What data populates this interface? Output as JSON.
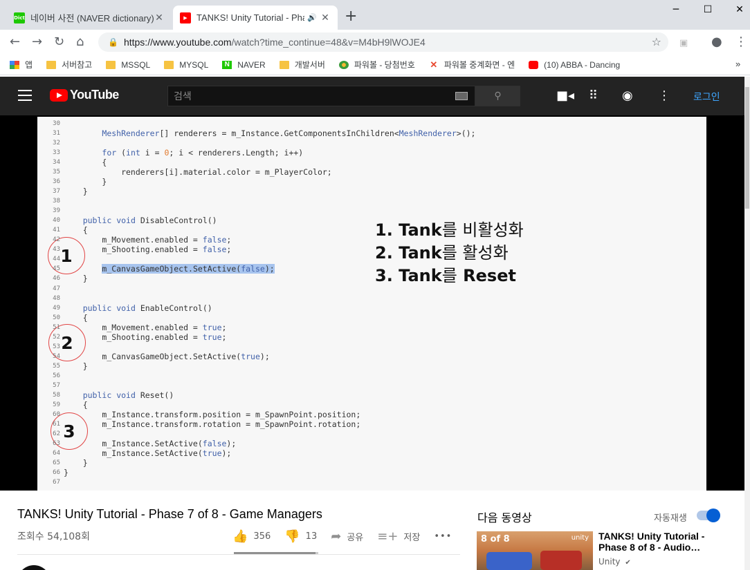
{
  "browser": {
    "tabs": [
      {
        "title": "네이버 사전 (NAVER dictionary)",
        "favicon": "naver-dict-icon",
        "close": "✕"
      },
      {
        "title": "TANKS! Unity Tutorial - Pha",
        "favicon": "youtube-icon",
        "close": "✕",
        "active": true
      }
    ],
    "new_tab": "+",
    "window_controls": {
      "minimize": "─",
      "maximize": "☐",
      "close": "✕"
    },
    "nav": {
      "back": "←",
      "forward": "→",
      "reload": "↻",
      "home": "⌂"
    },
    "url_host": "https://www.youtube.com",
    "url_path": "/watch?time_continue=48&v=M4bH9lWOJE4",
    "bookmarks": [
      {
        "label": "앱",
        "icon": "apps-grid-icon"
      },
      {
        "label": "서버참고",
        "icon": "folder-icon"
      },
      {
        "label": "MSSQL",
        "icon": "folder-icon"
      },
      {
        "label": "MYSQL",
        "icon": "folder-icon"
      },
      {
        "label": "NAVER",
        "icon": "naver-icon"
      },
      {
        "label": "개발서버",
        "icon": "folder-icon"
      },
      {
        "label": "파워볼 - 당첨번호",
        "icon": "powerball-icon"
      },
      {
        "label": "파워볼 중계화면 - 엔",
        "icon": "powerball-broadcast-icon"
      },
      {
        "label": "(10) ABBA - Dancing",
        "icon": "youtube-icon"
      }
    ],
    "bookmarks_more": "»"
  },
  "youtube": {
    "logo_text": "YouTube",
    "search_placeholder": "검색",
    "login": "로그인"
  },
  "code": {
    "lines": [
      {
        "n": "30",
        "t": ""
      },
      {
        "n": "31",
        "t": "        MeshRenderer[] renderers = m_Instance.GetComponentsInChildren<MeshRenderer>();"
      },
      {
        "n": "32",
        "t": ""
      },
      {
        "n": "33",
        "t": "        for (int i = 0; i < renderers.Length; i++)"
      },
      {
        "n": "34",
        "t": "        {"
      },
      {
        "n": "35",
        "t": "            renderers[i].material.color = m_PlayerColor;"
      },
      {
        "n": "36",
        "t": "        }"
      },
      {
        "n": "37",
        "t": "    }"
      },
      {
        "n": "38",
        "t": ""
      },
      {
        "n": "39",
        "t": ""
      },
      {
        "n": "40",
        "t": "    public void DisableControl()"
      },
      {
        "n": "41",
        "t": "    {"
      },
      {
        "n": "42",
        "t": "        m_Movement.enabled = false;"
      },
      {
        "n": "43",
        "t": "        m_Shooting.enabled = false;"
      },
      {
        "n": "44",
        "t": ""
      },
      {
        "n": "45",
        "t": "        m_CanvasGameObject.SetActive(false);"
      },
      {
        "n": "46",
        "t": "    }"
      },
      {
        "n": "47",
        "t": ""
      },
      {
        "n": "48",
        "t": ""
      },
      {
        "n": "49",
        "t": "    public void EnableControl()"
      },
      {
        "n": "50",
        "t": "    {"
      },
      {
        "n": "51",
        "t": "        m_Movement.enabled = true;"
      },
      {
        "n": "52",
        "t": "        m_Shooting.enabled = true;"
      },
      {
        "n": "53",
        "t": ""
      },
      {
        "n": "54",
        "t": "        m_CanvasGameObject.SetActive(true);"
      },
      {
        "n": "55",
        "t": "    }"
      },
      {
        "n": "56",
        "t": ""
      },
      {
        "n": "57",
        "t": ""
      },
      {
        "n": "58",
        "t": "    public void Reset()"
      },
      {
        "n": "59",
        "t": "    {"
      },
      {
        "n": "60",
        "t": "        m_Instance.transform.position = m_SpawnPoint.position;"
      },
      {
        "n": "61",
        "t": "        m_Instance.transform.rotation = m_SpawnPoint.rotation;"
      },
      {
        "n": "62",
        "t": ""
      },
      {
        "n": "63",
        "t": "        m_Instance.SetActive(false);"
      },
      {
        "n": "64",
        "t": "        m_Instance.SetActive(true);"
      },
      {
        "n": "65",
        "t": "    }"
      },
      {
        "n": "66",
        "t": "}"
      },
      {
        "n": "67",
        "t": ""
      }
    ],
    "circles": [
      "1",
      "2",
      "3"
    ],
    "notes": [
      {
        "bold": "1. Tank",
        "kr": "를 비활성화"
      },
      {
        "bold": "2. Tank",
        "kr": "를 활성화"
      },
      {
        "bold": "3. Tank",
        "kr": "를",
        "tail": " Reset"
      }
    ]
  },
  "video": {
    "title": "TANKS! Unity Tutorial - Phase 7 of 8 - Game Managers",
    "views": "조회수 54,108회",
    "likes": "356",
    "dislikes": "13",
    "share": "공유",
    "save": "저장",
    "more": "•••",
    "like_ratio": 0.965
  },
  "sidebar": {
    "up_next": "다음 동영상",
    "autoplay": "자동재생",
    "autoplay_on": true,
    "rec": {
      "title": "TANKS! Unity Tutorial - Phase 8 of 8 - Audio…",
      "channel": "Unity",
      "verified": "✔",
      "thumb_badge": "8 of 8",
      "thumb_logo": "unity"
    }
  }
}
